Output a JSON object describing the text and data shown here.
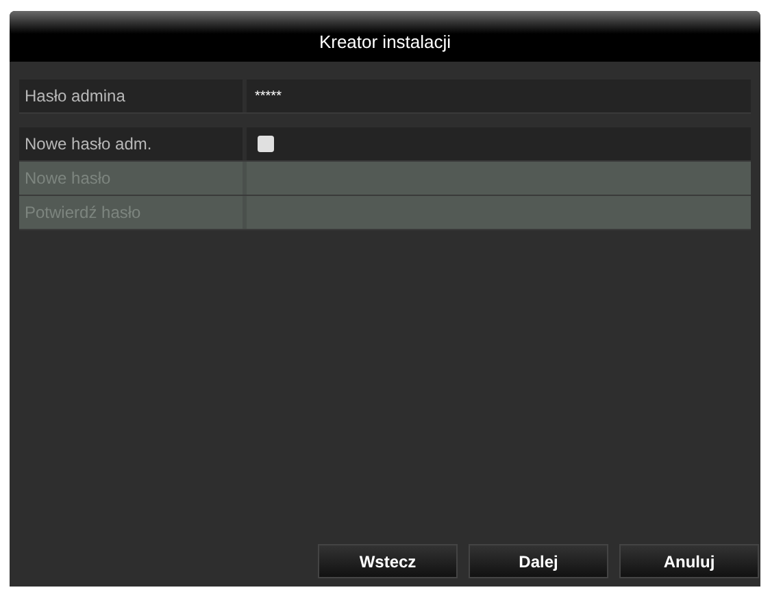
{
  "window": {
    "title": "Kreator instalacji"
  },
  "rows": [
    {
      "label": "Hasło admina",
      "kind": "password",
      "value": "*****",
      "disabled": false
    },
    {
      "label": "Nowe hasło adm.",
      "kind": "checkbox",
      "checked": false,
      "disabled": false
    },
    {
      "label": "Nowe hasło",
      "kind": "password",
      "disabled": true
    },
    {
      "label": "Potwierdź hasło",
      "kind": "password",
      "disabled": true
    }
  ],
  "buttons": [
    "Wstecz",
    "Dalej",
    "Anuluj"
  ]
}
